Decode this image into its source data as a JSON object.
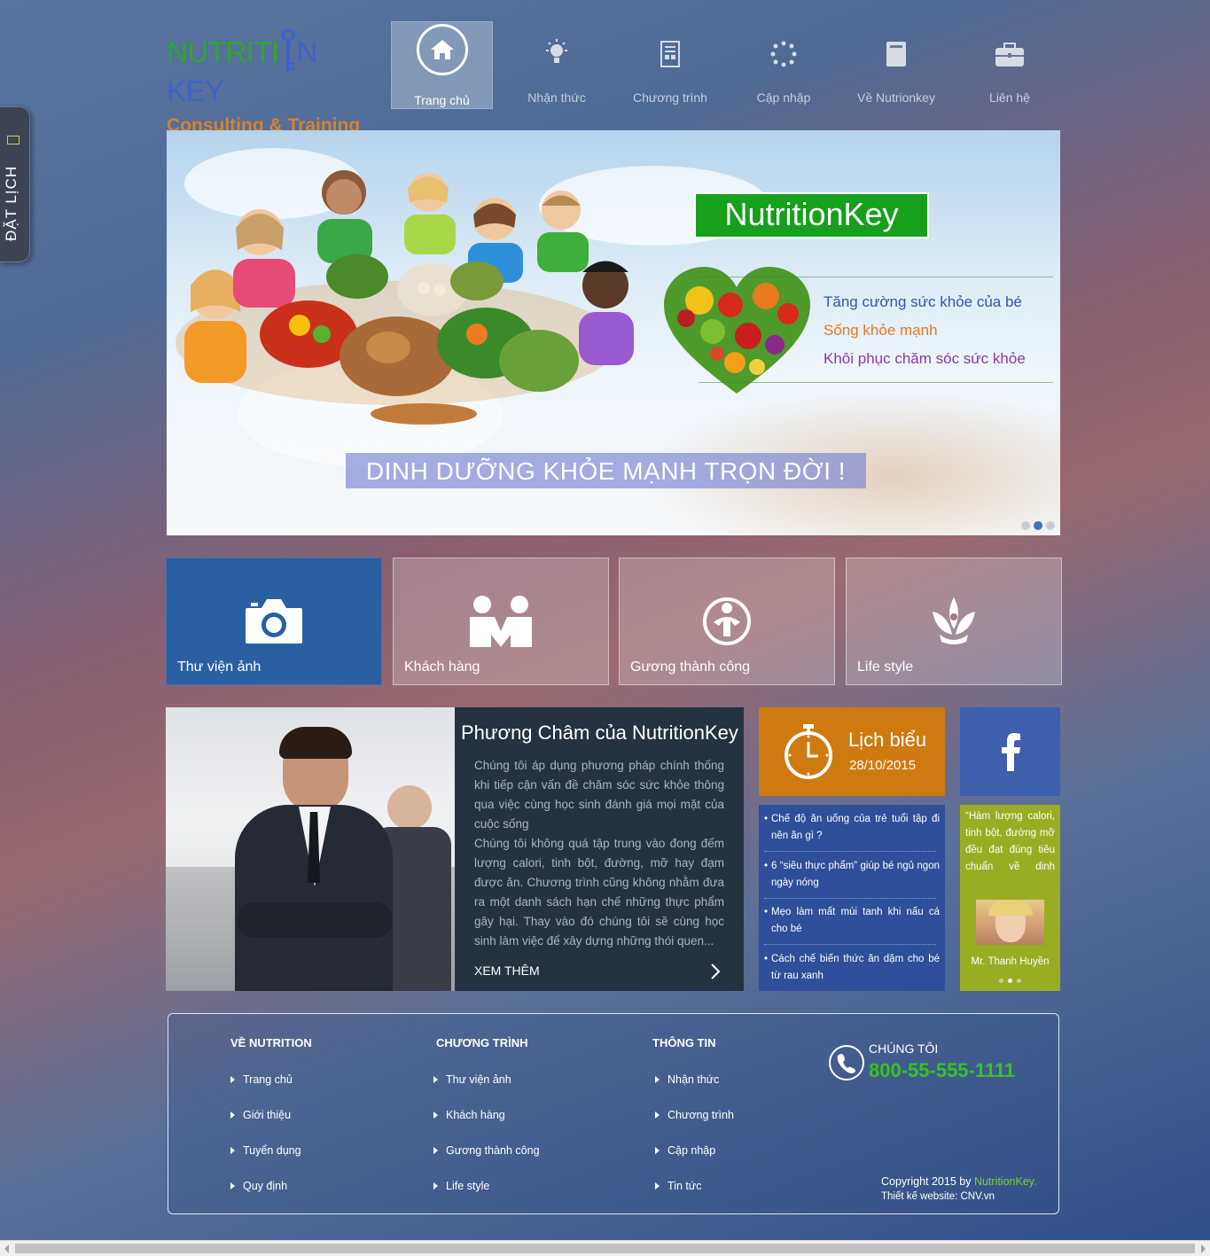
{
  "side_tab": {
    "label": "ĐẶT LỊCH"
  },
  "logo": {
    "line1_a": "NUTRITI",
    "line1_b": "N KEY",
    "line2": "Consulting & Training"
  },
  "nav": [
    {
      "label": "Trang chủ",
      "icon": "home-icon",
      "active": true
    },
    {
      "label": "Nhận thức",
      "icon": "lightbulb-icon"
    },
    {
      "label": "Chương trình",
      "icon": "document-icon"
    },
    {
      "label": "Cập nhập",
      "icon": "spinner-icon"
    },
    {
      "label": "Về Nutrionkey",
      "icon": "book-icon"
    },
    {
      "label": "Liên hệ",
      "icon": "briefcase-icon"
    }
  ],
  "hero": {
    "brand": "NutritionKey",
    "lines": [
      {
        "text": "Tăng cường sức khỏe của bé",
        "color": "#3456a8"
      },
      {
        "text": "Sống khỏe mạnh",
        "color": "#e07a24"
      },
      {
        "text": "Khôi phục chăm sóc sức khỏe",
        "color": "#8b3ba2"
      }
    ],
    "slogan": "DINH DƯỠNG KHỎE MẠNH TRỌN ĐỜI !",
    "slide_count": 3,
    "active_slide": 2
  },
  "tiles": [
    {
      "label": "Thư viện ảnh",
      "icon": "camera-icon"
    },
    {
      "label": "Khách hàng",
      "icon": "customers-icon"
    },
    {
      "label": "Gương thành công",
      "icon": "success-icon"
    },
    {
      "label": "Life style",
      "icon": "lotus-icon"
    }
  ],
  "philosophy": {
    "title": "Phương Châm của NutritionKey",
    "paragraph1": "Chúng tôi áp dụng phương pháp chính thống khi tiếp cận vấn đề chăm sóc sức khỏe thông qua việc cùng học sinh đánh giá mọi mặt của cuộc sống",
    "paragraph2": "Chúng tôi không quá tập trung vào đong đếm lượng calori, tinh bột, đường, mỡ hay đạm được ăn. Chương trình cũng không nhằm đưa ra một danh sách hạn chế những thực phẩm gây hại. Thay vào đó chúng tôi sẽ cùng học sinh làm việc để xây dựng những thói quen...",
    "more": "XEM THÊM"
  },
  "schedule": {
    "title": "Lịch biểu",
    "date": "28/10/2015"
  },
  "news": [
    "Chế độ ăn uống của trẻ tuổi tập đi nên ăn gì ?",
    "6 “siêu thực phẩm” giúp bé ngủ ngon ngày nóng",
    "Mẹo làm mất mùi tanh khi nấu cá cho bé",
    "Cách chế biến thức ăn dặm cho bé từ rau xanh"
  ],
  "quote": {
    "text": "“Hàm lượng calori, tinh bột, đường mỡ đều đạt đúng tiêu chuẩn về dinh",
    "name": "Mr. Thanh Huyền"
  },
  "footer": {
    "columns": [
      {
        "title": "VỀ NUTRITION",
        "links": [
          "Trang chủ",
          "Giới thiệu",
          "Tuyển dụng",
          "Quy định"
        ]
      },
      {
        "title": "CHƯƠNG TRÌNH",
        "links": [
          "Thư viện ảnh",
          "Khách hàng",
          "Gương thành công",
          "Life style"
        ]
      },
      {
        "title": "THÔNG TIN",
        "links": [
          "Nhận thức",
          "Chương trình",
          "Cập nhập",
          "Tin tức"
        ]
      }
    ],
    "contact_label": "CHÚNG TÔI",
    "phone": "800-55-555-1111",
    "copyright_prefix": "Copyright 2015 by ",
    "copyright_brand": "NutritionKey.",
    "designer": "Thiết kế website: CNV.vn"
  },
  "colors": {
    "accent_green": "#16a01b",
    "tile_blue": "#2a60a1",
    "schedule_orange": "#cf7a10",
    "news_blue": "#2e4f9a",
    "facebook_blue": "#3d5fad",
    "quote_green": "#99ad23",
    "phone_green": "#36c21f"
  }
}
